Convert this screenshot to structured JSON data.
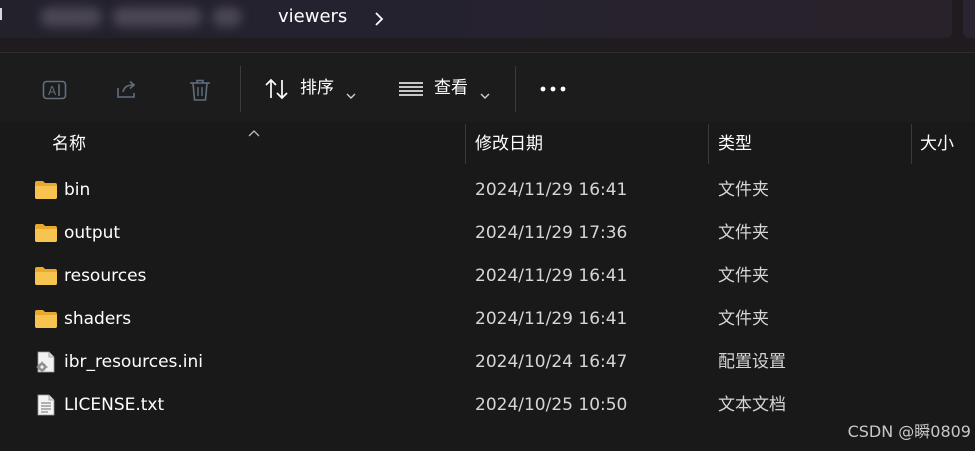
{
  "address_bar": {
    "current_folder": "viewers",
    "separator_icon": "chevron-right-icon"
  },
  "toolbar": {
    "rename_icon": "rename-icon",
    "share_icon": "share-icon",
    "delete_icon": "trash-icon",
    "sort_label": "排序",
    "sort_icon": "sort-arrows-icon",
    "view_label": "查看",
    "view_icon": "view-lines-icon",
    "more_icon": "more-dots-icon"
  },
  "columns": {
    "name": "名称",
    "date_modified": "修改日期",
    "type": "类型",
    "size": "大小"
  },
  "files": [
    {
      "name": "bin",
      "date": "2024/11/29 16:41",
      "type": "文件夹",
      "icon": "folder-icon"
    },
    {
      "name": "output",
      "date": "2024/11/29 17:36",
      "type": "文件夹",
      "icon": "folder-icon"
    },
    {
      "name": "resources",
      "date": "2024/11/29 16:41",
      "type": "文件夹",
      "icon": "folder-icon"
    },
    {
      "name": "shaders",
      "date": "2024/11/29 16:41",
      "type": "文件夹",
      "icon": "folder-icon"
    },
    {
      "name": "ibr_resources.ini",
      "date": "2024/10/24 16:47",
      "type": "配置设置",
      "icon": "config-file-icon"
    },
    {
      "name": "LICENSE.txt",
      "date": "2024/10/25 10:50",
      "type": "文本文档",
      "icon": "text-file-icon"
    }
  ],
  "watermark": "CSDN @瞬0809",
  "colors": {
    "background": "#191919",
    "toolbar": "#1c1c1c",
    "folder_yellow": "#f3c14a",
    "text_primary": "#ffffff",
    "text_secondary": "#d6d6d6"
  }
}
